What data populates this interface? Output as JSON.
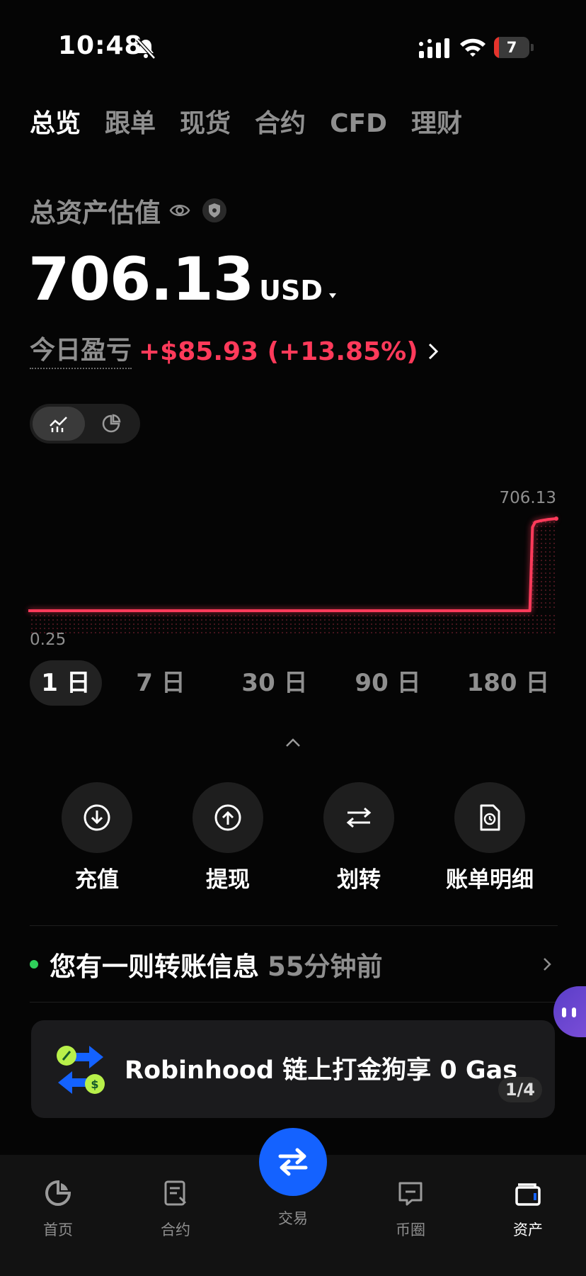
{
  "status_bar": {
    "time": "10:48",
    "battery": "7"
  },
  "top_tabs": [
    "总览",
    "跟单",
    "现货",
    "合约",
    "CFD",
    "理财"
  ],
  "asset": {
    "label": "总资产估值",
    "value": "706.13",
    "currency": "USD"
  },
  "pnl": {
    "label": "今日盈亏",
    "value": "+$85.93 (+13.85%)"
  },
  "chart_data": {
    "type": "line",
    "max_label": "706.13",
    "min_label": "0.25",
    "color": "#ff3a5a",
    "x": [
      0,
      0.95,
      0.955,
      0.96,
      0.97,
      0.985,
      1.0
    ],
    "values": [
      0.25,
      0.25,
      640,
      680,
      690,
      700,
      706.13
    ],
    "ylim": [
      0.25,
      706.13
    ],
    "grid": false
  },
  "range_tabs": [
    "1 日",
    "7 日",
    "30 日",
    "90 日",
    "180 日"
  ],
  "actions": [
    {
      "label": "充值",
      "icon": "deposit-icon"
    },
    {
      "label": "提现",
      "icon": "withdraw-icon"
    },
    {
      "label": "划转",
      "icon": "transfer-icon"
    },
    {
      "label": "账单明细",
      "icon": "bill-icon"
    }
  ],
  "notice": {
    "text": "您有一则转账信息",
    "time": "55分钟前"
  },
  "promo": {
    "text": "Robinhood 链上打金狗享 0 Gas",
    "page": "1/4"
  },
  "bottom_nav": [
    {
      "label": "首页",
      "icon": "home-icon"
    },
    {
      "label": "合约",
      "icon": "contract-icon"
    },
    {
      "label": "交易",
      "icon": "trade-icon"
    },
    {
      "label": "币圈",
      "icon": "community-icon"
    },
    {
      "label": "资产",
      "icon": "wallet-icon"
    }
  ],
  "colors": {
    "accent": "#1462ff",
    "loss_gain": "#ff3a5a",
    "dot": "#2fd05a"
  }
}
